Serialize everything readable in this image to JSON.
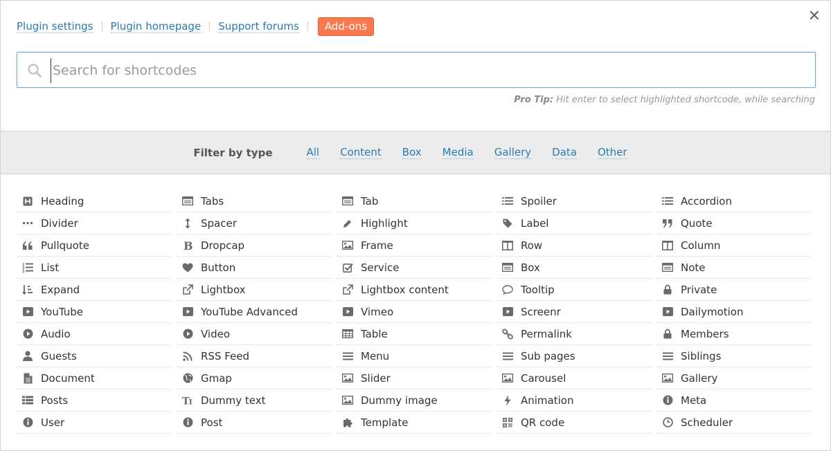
{
  "toplinks": {
    "plugin_settings": "Plugin settings",
    "plugin_homepage": "Plugin homepage",
    "support_forums": "Support forums",
    "addons": "Add-ons"
  },
  "close_label": "✕",
  "search": {
    "placeholder": "Search for shortcodes",
    "value": ""
  },
  "protip": {
    "label": "Pro Tip:",
    "text": "Hit enter to select highlighted shortcode, while searching"
  },
  "filter": {
    "label": "Filter by type",
    "options": [
      "All",
      "Content",
      "Box",
      "Media",
      "Gallery",
      "Data",
      "Other"
    ]
  },
  "colors": {
    "link": "#2a7ab0",
    "addons_bg": "#fa7850",
    "filter_bg": "#ececec",
    "search_border": "#6fa7d8"
  },
  "shortcodes": [
    {
      "label": "Heading",
      "icon": "heading-icon"
    },
    {
      "label": "Tabs",
      "icon": "tabs-icon"
    },
    {
      "label": "Tab",
      "icon": "tab-icon"
    },
    {
      "label": "Spoiler",
      "icon": "list-icon"
    },
    {
      "label": "Accordion",
      "icon": "list-icon"
    },
    {
      "label": "Divider",
      "icon": "ellipsis-icon"
    },
    {
      "label": "Spacer",
      "icon": "arrows-vertical-icon"
    },
    {
      "label": "Highlight",
      "icon": "pencil-icon"
    },
    {
      "label": "Label",
      "icon": "tag-icon"
    },
    {
      "label": "Quote",
      "icon": "quote-right-icon"
    },
    {
      "label": "Pullquote",
      "icon": "quote-left-icon"
    },
    {
      "label": "Dropcap",
      "icon": "bold-icon"
    },
    {
      "label": "Frame",
      "icon": "image-icon"
    },
    {
      "label": "Row",
      "icon": "columns-icon"
    },
    {
      "label": "Column",
      "icon": "columns-icon"
    },
    {
      "label": "List",
      "icon": "list-ol-icon"
    },
    {
      "label": "Button",
      "icon": "heart-icon"
    },
    {
      "label": "Service",
      "icon": "check-square-icon"
    },
    {
      "label": "Box",
      "icon": "box-icon"
    },
    {
      "label": "Note",
      "icon": "note-icon"
    },
    {
      "label": "Expand",
      "icon": "sort-icon"
    },
    {
      "label": "Lightbox",
      "icon": "external-link-icon"
    },
    {
      "label": "Lightbox content",
      "icon": "external-link-icon"
    },
    {
      "label": "Tooltip",
      "icon": "comment-icon"
    },
    {
      "label": "Private",
      "icon": "lock-icon"
    },
    {
      "label": "YouTube",
      "icon": "play-square-icon"
    },
    {
      "label": "YouTube Advanced",
      "icon": "play-square-icon"
    },
    {
      "label": "Vimeo",
      "icon": "play-square-icon"
    },
    {
      "label": "Screenr",
      "icon": "play-square-icon"
    },
    {
      "label": "Dailymotion",
      "icon": "play-square-icon"
    },
    {
      "label": "Audio",
      "icon": "play-circle-icon"
    },
    {
      "label": "Video",
      "icon": "play-circle-icon"
    },
    {
      "label": "Table",
      "icon": "table-icon"
    },
    {
      "label": "Permalink",
      "icon": "link-icon"
    },
    {
      "label": "Members",
      "icon": "lock-icon"
    },
    {
      "label": "Guests",
      "icon": "user-icon"
    },
    {
      "label": "RSS Feed",
      "icon": "rss-icon"
    },
    {
      "label": "Menu",
      "icon": "bars-icon"
    },
    {
      "label": "Sub pages",
      "icon": "bars-icon"
    },
    {
      "label": "Siblings",
      "icon": "bars-icon"
    },
    {
      "label": "Document",
      "icon": "file-icon"
    },
    {
      "label": "Gmap",
      "icon": "globe-icon"
    },
    {
      "label": "Slider",
      "icon": "image-icon"
    },
    {
      "label": "Carousel",
      "icon": "image-icon"
    },
    {
      "label": "Gallery",
      "icon": "image-icon"
    },
    {
      "label": "Posts",
      "icon": "th-list-icon"
    },
    {
      "label": "Dummy text",
      "icon": "text-height-icon"
    },
    {
      "label": "Dummy image",
      "icon": "image-icon"
    },
    {
      "label": "Animation",
      "icon": "bolt-icon"
    },
    {
      "label": "Meta",
      "icon": "info-circle-icon"
    },
    {
      "label": "User",
      "icon": "info-circle-icon"
    },
    {
      "label": "Post",
      "icon": "info-circle-icon"
    },
    {
      "label": "Template",
      "icon": "puzzle-icon"
    },
    {
      "label": "QR code",
      "icon": "qrcode-icon"
    },
    {
      "label": "Scheduler",
      "icon": "clock-icon"
    }
  ]
}
